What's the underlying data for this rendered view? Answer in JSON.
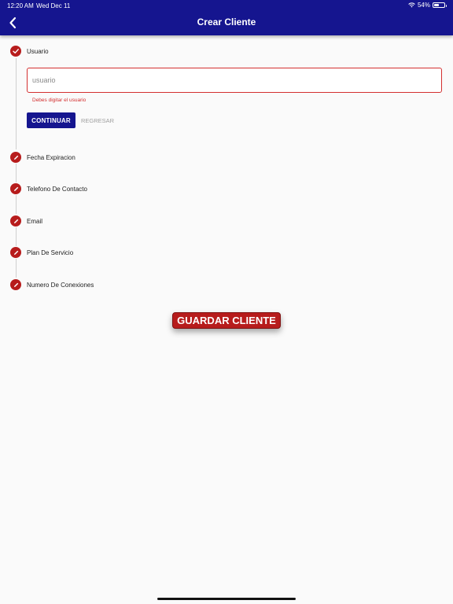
{
  "status_bar": {
    "time": "12:20 AM",
    "date": "Wed Dec 11",
    "battery": "54%",
    "battery_level": 0.54
  },
  "header": {
    "title": "Crear Cliente",
    "back_icon": "chevron-left-icon"
  },
  "steps": [
    {
      "label": "Usuario",
      "state": "completed",
      "icon": "check-icon"
    },
    {
      "label": "Fecha Expiracion",
      "state": "pending",
      "icon": "pencil-icon"
    },
    {
      "label": "Telefono De Contacto",
      "state": "pending",
      "icon": "pencil-icon"
    },
    {
      "label": "Email",
      "state": "pending",
      "icon": "pencil-icon"
    },
    {
      "label": "Plan De Servicio",
      "state": "pending",
      "icon": "pencil-icon"
    },
    {
      "label": "Numero De Conexiones",
      "state": "pending",
      "icon": "pencil-icon"
    }
  ],
  "usuario_step": {
    "input_value": "",
    "input_placeholder": "usuario",
    "error": "Debes digitar el usuario",
    "continue_label": "CONTINUAR",
    "back_label": "REGRESAR"
  },
  "save_label": "GUARDAR CLIENTE",
  "colors": {
    "primary": "#15158f",
    "accent": "#b71c1c",
    "error": "#d32f2f"
  }
}
